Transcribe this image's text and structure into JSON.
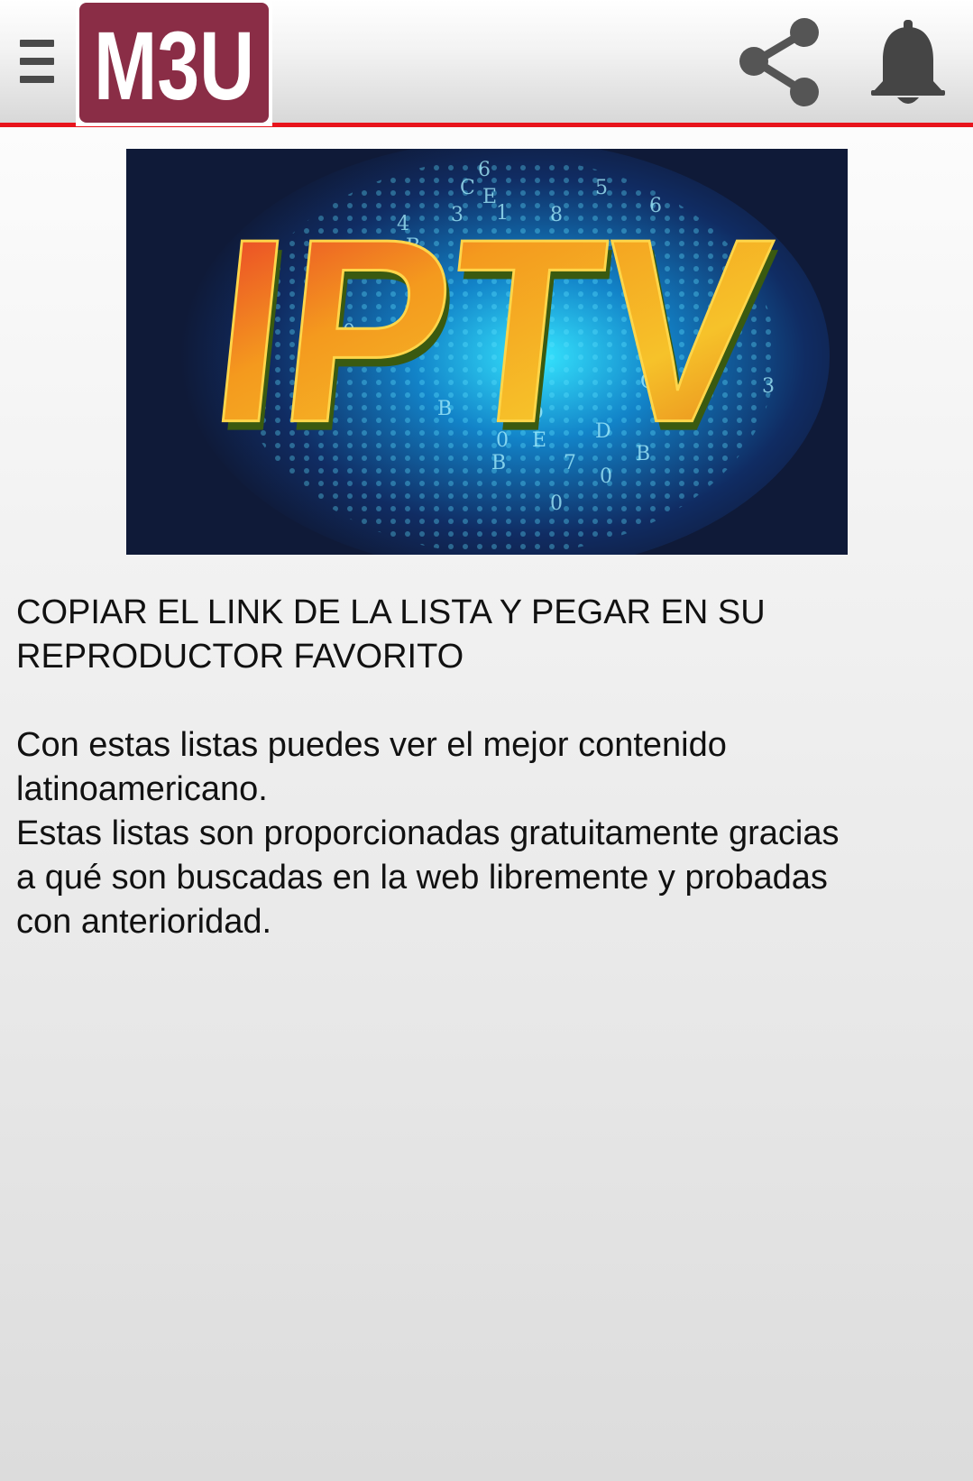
{
  "header": {
    "menu_icon": "hamburger-menu-icon",
    "logo_text": "M3U",
    "share_icon": "share-icon",
    "notification_icon": "bell-icon",
    "accent_color": "#e8141c",
    "logo_bg_color": "#8a2d46"
  },
  "banner": {
    "text": "IPTV"
  },
  "content": {
    "heading_line1": "COPIAR EL LINK DE LA LISTA Y PEGAR EN SU",
    "heading_line2": "REPRODUCTOR FAVORITO",
    "body_line1": "Con estas listas puedes ver el mejor contenido",
    "body_line2": "latinoamericano.",
    "body_line3": "Estas listas son proporcionadas gratuitamente gracias",
    "body_line4": "a qué son buscadas en la web libremente y probadas",
    "body_line5": "con anterioridad."
  }
}
